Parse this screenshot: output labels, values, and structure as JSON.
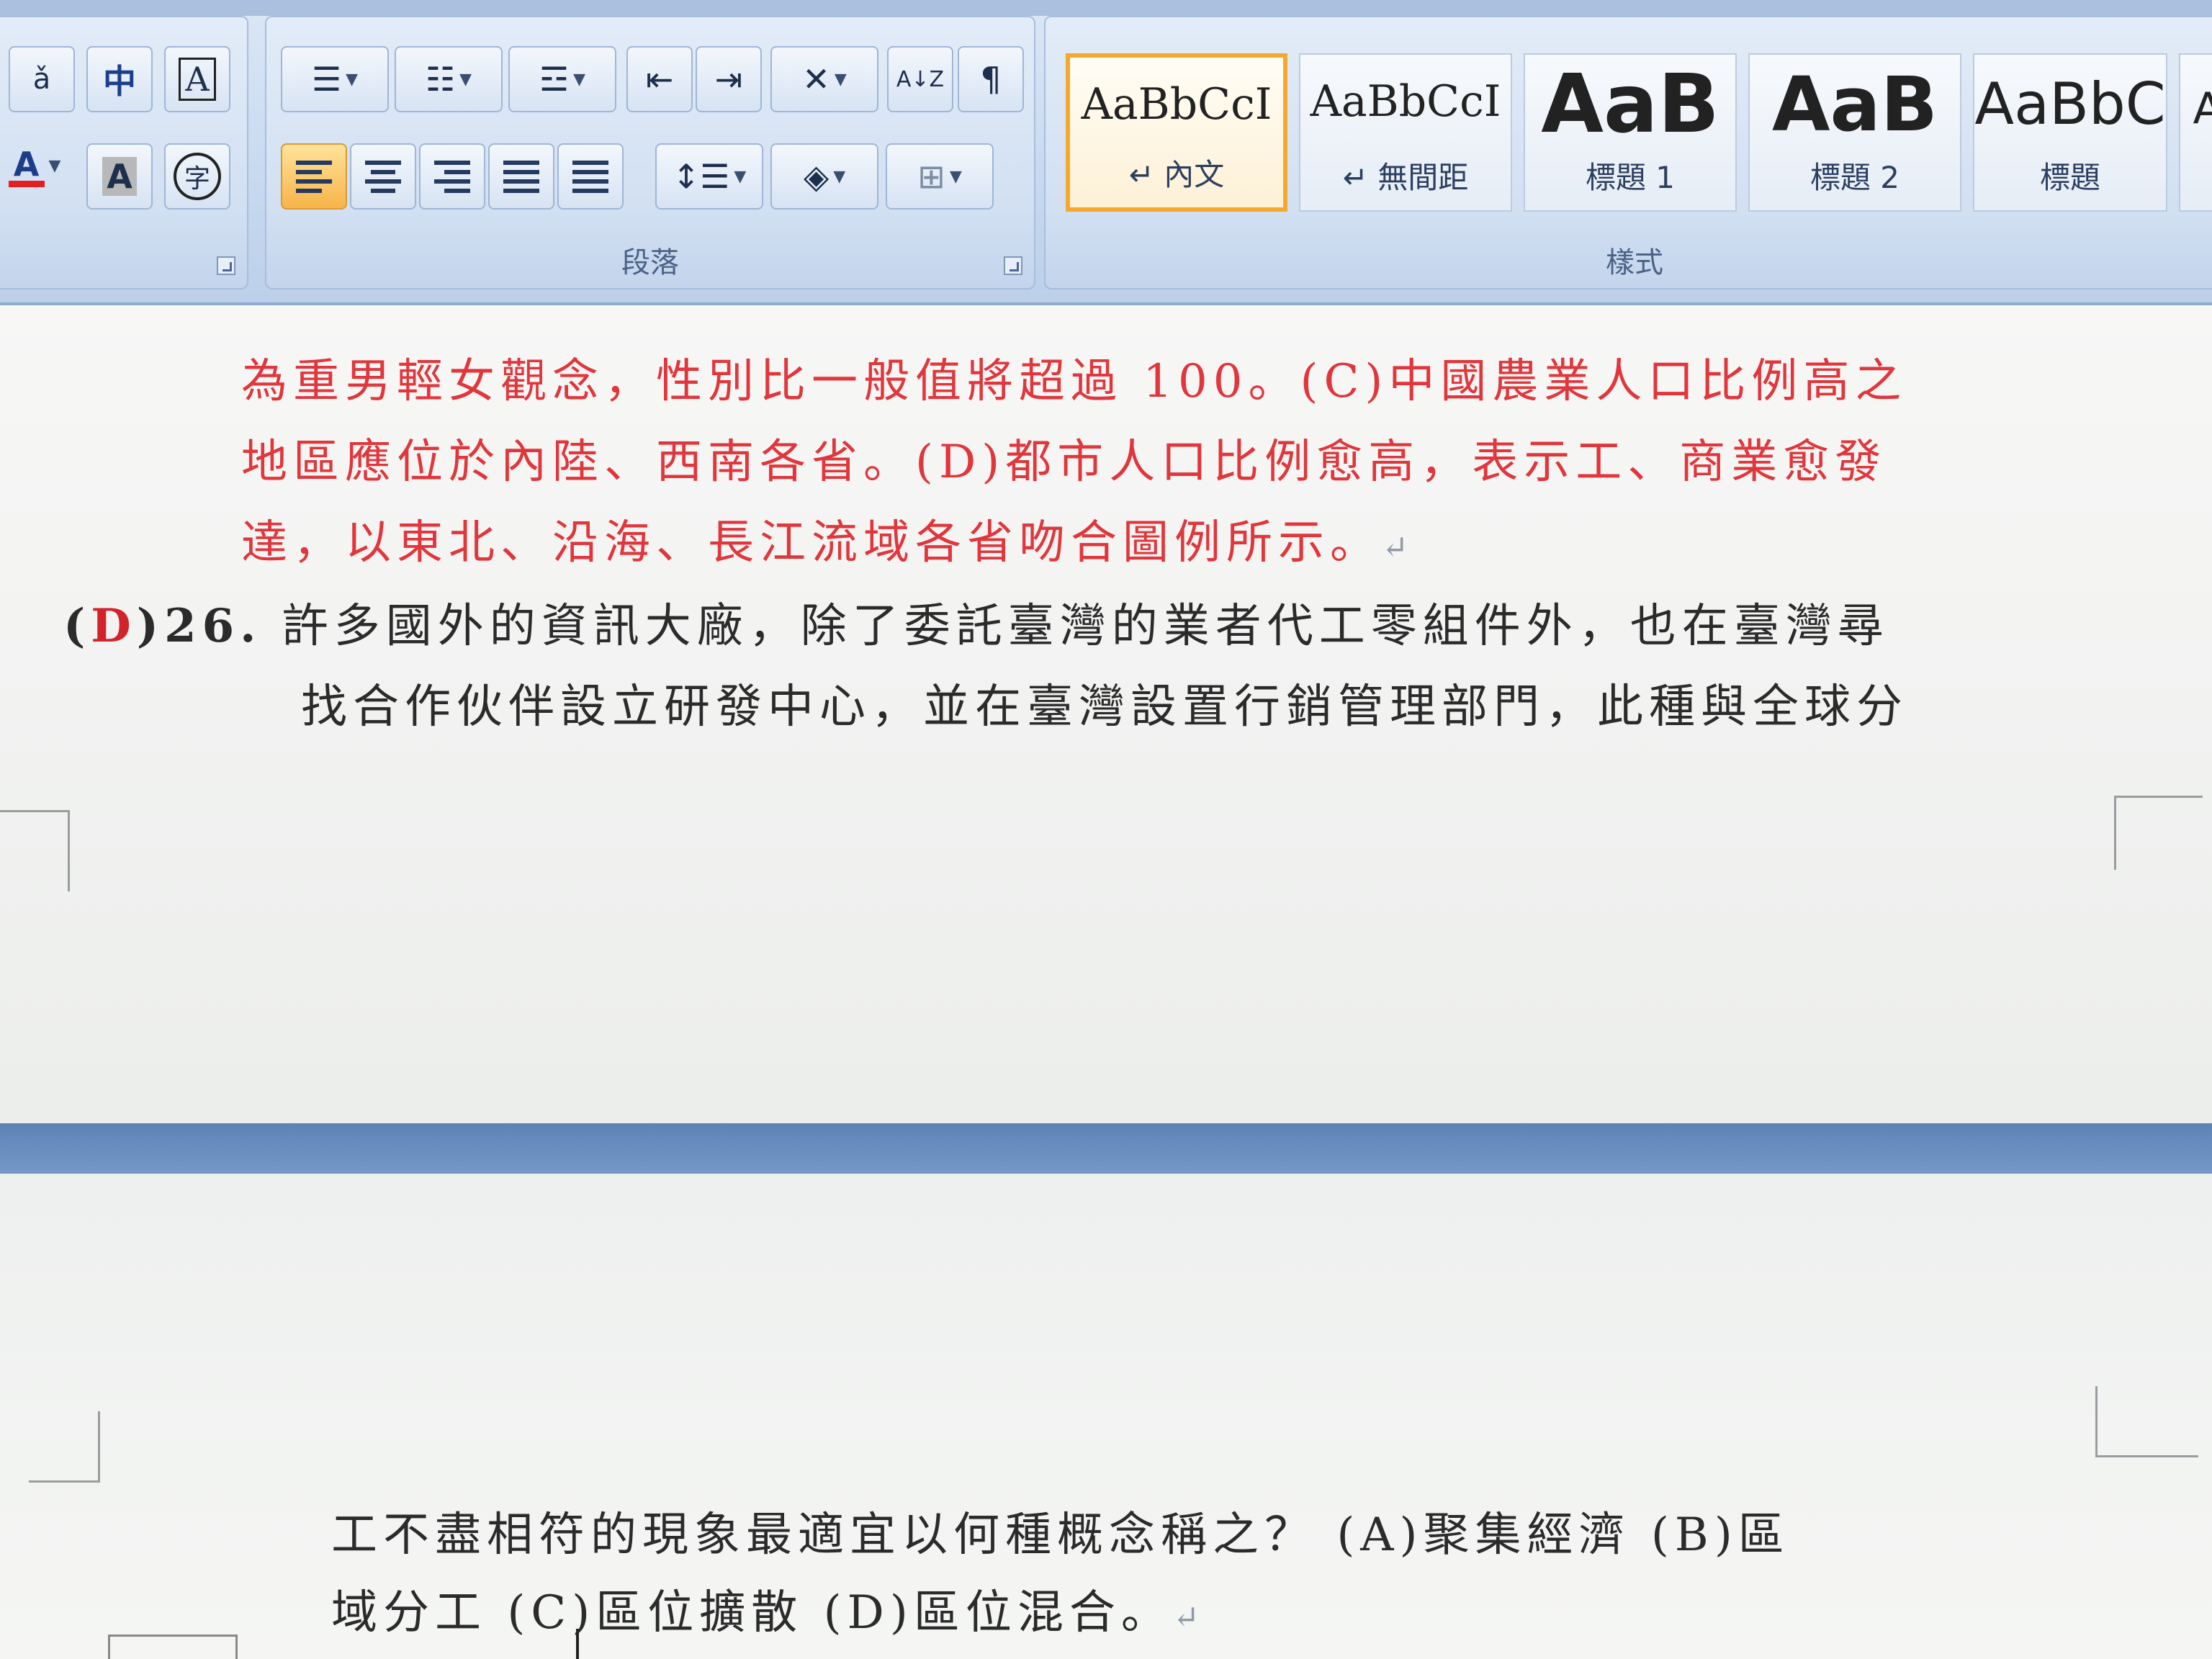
{
  "ribbon": {
    "groups": {
      "paragraph_label": "段落",
      "styles_label": "樣式"
    },
    "font_tools": {
      "phonetic_icon": "ruby-text-icon",
      "chinese_layout": "中",
      "char_border": "A",
      "font_color": "A",
      "char_shading": "A",
      "enclose_char": "字"
    },
    "paragraph_tools": {
      "sort": "A↓Z"
    },
    "styles": [
      {
        "sample": "AaBbCcI",
        "name": "↵ 內文",
        "selected": true
      },
      {
        "sample": "AaBbCcI",
        "name": "↵ 無間距",
        "selected": false
      },
      {
        "sample": "AaB",
        "name": "標題 1",
        "selected": false
      },
      {
        "sample": "AaB",
        "name": "標題 2",
        "selected": false
      },
      {
        "sample": "AaBbC",
        "name": "標題",
        "selected": false
      },
      {
        "sample": "A",
        "name": "",
        "selected": false
      }
    ]
  },
  "document": {
    "answer_lines": [
      "為重男輕女觀念，性別比一般值將超過 100。(C)中國農業人口比例高之",
      "地區應位於內陸、西南各省。(D)都市人口比例愈高，表示工、商業愈發",
      "達，以東北、沿海、長江流域各省吻合圖例所示。"
    ],
    "question": {
      "open_paren": "(",
      "answer": "D",
      "number": ")26.",
      "line1": "許多國外的資訊大廠，除了委託臺灣的業者代工零組件外，也在臺灣尋",
      "line2": "找合作伙伴設立研發中心，並在臺灣設置行銷管理部門，此種與全球分",
      "line3": "工不盡相符的現象最適宜以何種概念稱之？ (A)聚集經濟 (B)區",
      "line4": "域分工 (C)區位擴散 (D)區位混合。"
    },
    "paragraph_mark": "↵"
  },
  "colors": {
    "answer_text": "#e0363c",
    "body_text": "#2b2b2b",
    "page_gap": "#5d83b5",
    "selected_style_border": "#f4a92e"
  }
}
